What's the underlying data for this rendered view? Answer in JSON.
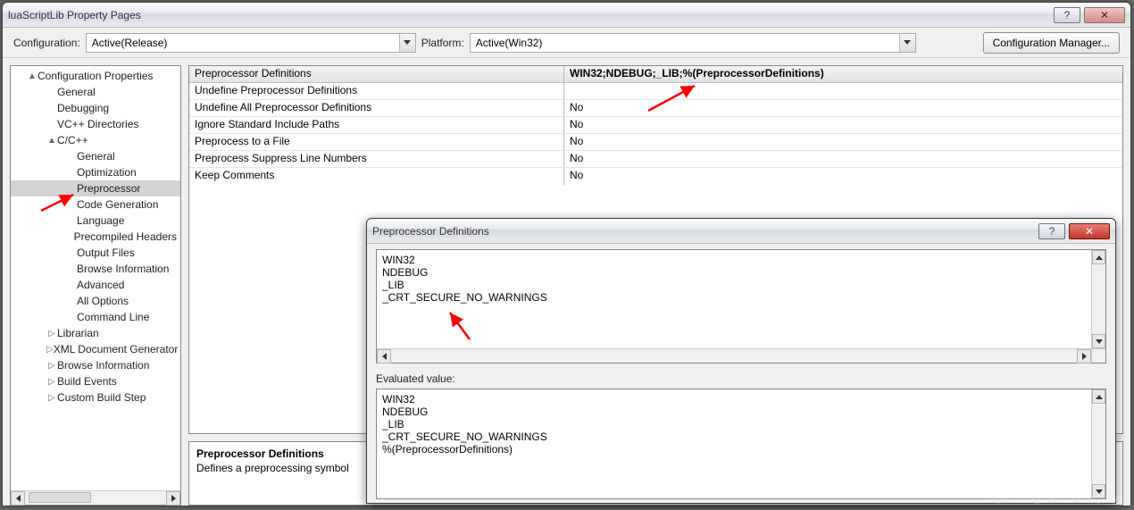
{
  "mainWindow": {
    "title": "luaScriptLib Property Pages",
    "help_glyph": "?",
    "close_glyph": "✕"
  },
  "toolbar": {
    "configuration_label": "Configuration:",
    "configuration_value": "Active(Release)",
    "platform_label": "Platform:",
    "platform_value": "Active(Win32)",
    "config_manager_label": "Configuration Manager..."
  },
  "tree": {
    "items": [
      {
        "depth": 1,
        "exp": "▲",
        "label": "Configuration Properties"
      },
      {
        "depth": 2,
        "exp": "",
        "label": "General"
      },
      {
        "depth": 2,
        "exp": "",
        "label": "Debugging"
      },
      {
        "depth": 2,
        "exp": "",
        "label": "VC++ Directories"
      },
      {
        "depth": 2,
        "exp": "▲",
        "label": "C/C++"
      },
      {
        "depth": 3,
        "exp": "",
        "label": "General"
      },
      {
        "depth": 3,
        "exp": "",
        "label": "Optimization"
      },
      {
        "depth": 3,
        "exp": "",
        "label": "Preprocessor",
        "selected": true
      },
      {
        "depth": 3,
        "exp": "",
        "label": "Code Generation"
      },
      {
        "depth": 3,
        "exp": "",
        "label": "Language"
      },
      {
        "depth": 3,
        "exp": "",
        "label": "Precompiled Headers"
      },
      {
        "depth": 3,
        "exp": "",
        "label": "Output Files"
      },
      {
        "depth": 3,
        "exp": "",
        "label": "Browse Information"
      },
      {
        "depth": 3,
        "exp": "",
        "label": "Advanced"
      },
      {
        "depth": 3,
        "exp": "",
        "label": "All Options"
      },
      {
        "depth": 3,
        "exp": "",
        "label": "Command Line"
      },
      {
        "depth": 2,
        "exp": "▷",
        "label": "Librarian"
      },
      {
        "depth": 2,
        "exp": "▷",
        "label": "XML Document Generator"
      },
      {
        "depth": 2,
        "exp": "▷",
        "label": "Browse Information"
      },
      {
        "depth": 2,
        "exp": "▷",
        "label": "Build Events"
      },
      {
        "depth": 2,
        "exp": "▷",
        "label": "Custom Build Step"
      }
    ]
  },
  "grid": {
    "rows": [
      {
        "name": "Preprocessor Definitions",
        "value": "WIN32;NDEBUG;_LIB;%(PreprocessorDefinitions)",
        "header": true
      },
      {
        "name": "Undefine Preprocessor Definitions",
        "value": ""
      },
      {
        "name": "Undefine All Preprocessor Definitions",
        "value": "No"
      },
      {
        "name": "Ignore Standard Include Paths",
        "value": "No"
      },
      {
        "name": "Preprocess to a File",
        "value": "No"
      },
      {
        "name": "Preprocess Suppress Line Numbers",
        "value": "No"
      },
      {
        "name": "Keep Comments",
        "value": "No"
      }
    ]
  },
  "description": {
    "title": "Preprocessor Definitions",
    "body": "Defines a preprocessing symbol"
  },
  "popup": {
    "title": "Preprocessor Definitions",
    "help_glyph": "?",
    "close_glyph": "✕",
    "edit_text": "WIN32\nNDEBUG\n_LIB\n_CRT_SECURE_NO_WARNINGS",
    "evaluated_label": "Evaluated value:",
    "evaluated_text": "WIN32\nNDEBUG\n_LIB\n_CRT_SECURE_NO_WARNINGS\n%(PreprocessorDefinitions)"
  },
  "watermark": "https://blog.csdn.net/njssss"
}
